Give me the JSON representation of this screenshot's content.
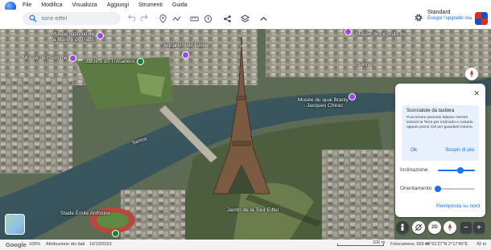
{
  "menu": [
    "File",
    "Modifica",
    "Visualizza",
    "Aggiungi",
    "Strumenti",
    "Guida"
  ],
  "search": {
    "placeholder": "torre eiffel"
  },
  "account": {
    "name": "Standard",
    "link": "Esegui l'upgrade ora"
  },
  "map_labels": {
    "musee_marine": "Musée national de\nla Marine de Paris",
    "musee_homme": "Musée de l'Homme",
    "jardins_trocadero": "Jardins du Trocadéro",
    "aquarium": "Aquarium de Paris",
    "seine_top": "Senna",
    "seine_left": "Senna",
    "musee_egouts": "Musée des égouts de",
    "quai_branly": "Musée du quai Branly\n- Jacques Chirac",
    "jardin_tour": "Jardin de la Tour Eiffel",
    "stade": "Stade Émile Anthoine"
  },
  "panel": {
    "tip_title": "Scorciatoie da tastiera",
    "tip_body": "Puoi tenere premuto Maiusc mentre trascini la Terra per inclinarla e ruotarla oppure premi Ctrl per guardarti intorno.",
    "tip_ok": "Ok",
    "tip_more": "Scopri di più",
    "tilt_label": "Inclinazione",
    "tilt_value": 0.6,
    "orient_label": "Orientamento",
    "orient_value": 0.0,
    "reset": "Reimposta su nord"
  },
  "controls": {
    "view_mode": "2D"
  },
  "status": {
    "logo": "Google",
    "zoom": "100%",
    "attribution": "Attribuzione dei dati",
    "date": "16/10/2023",
    "scale": "100 m",
    "camera": "Fotocamera: 669 m",
    "coords": "48°51'27\"N 2°17'40\"E",
    "altitude": "42 m"
  },
  "colors": {
    "accent": "#1a73e8",
    "pin": "#a142f4",
    "panel_bg": "#ffffff",
    "tip_bg": "#e8f0fe"
  }
}
